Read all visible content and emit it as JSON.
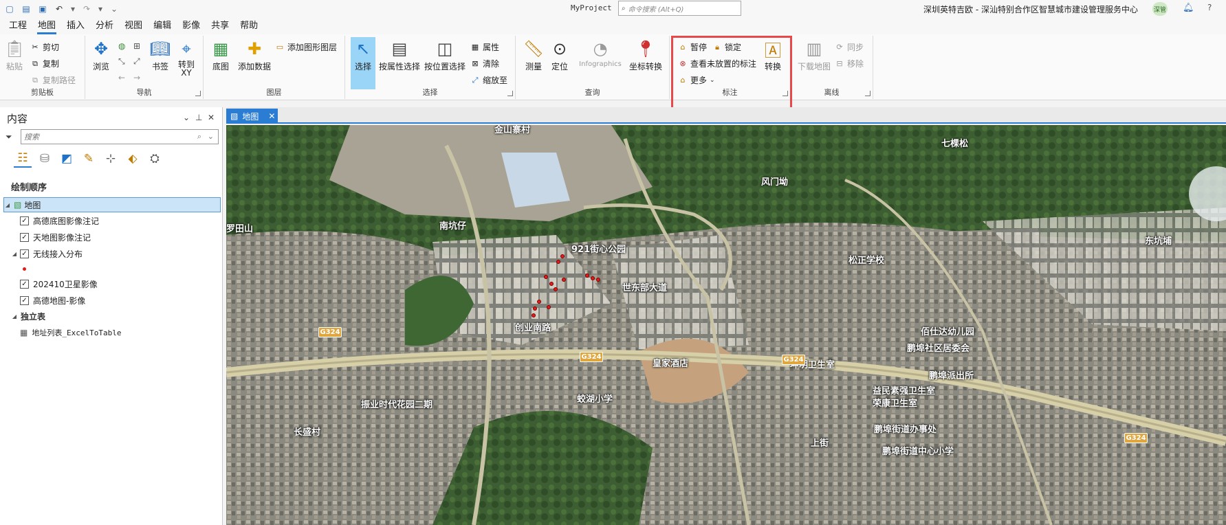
{
  "titlebar": {
    "project_name": "MyProject",
    "command_search_placeholder": "命令搜索 (Alt+Q)",
    "organization": "深圳英特吉欧 - 深汕特别合作区智慧城市建设管理服务中心",
    "user_badge": "深管",
    "qat_icons": [
      "new-project-icon",
      "open-project-icon",
      "save-project-icon",
      "undo-icon",
      "undo-dropdown-icon",
      "redo-icon",
      "redo-dropdown-icon",
      "customize-qat-icon"
    ]
  },
  "menu": {
    "items": [
      "工程",
      "地图",
      "插入",
      "分析",
      "视图",
      "编辑",
      "影像",
      "共享",
      "帮助"
    ],
    "active": "地图"
  },
  "ribbon": {
    "clipboard": {
      "label": "剪贴板",
      "paste": "粘贴",
      "cut": "剪切",
      "copy": "复制",
      "copy_path": "复制路径"
    },
    "navigate": {
      "label": "导航",
      "explore": "浏览",
      "bookmarks": "书签",
      "goto_xy": "转到\nXY"
    },
    "layer": {
      "label": "图层",
      "basemap": "底图",
      "add_data": "添加数据",
      "add_graphics": "添加图形图层"
    },
    "selection": {
      "label": "选择",
      "select": "选择",
      "by_attr": "按属性选择",
      "by_loc": "按位置选择",
      "attributes": "属性",
      "clear": "清除",
      "zoom_to": "缩放至"
    },
    "inquiry": {
      "label": "查询",
      "measure": "测量",
      "locate": "定位",
      "infographics": "Infographics",
      "convert_coords": "坐标转换"
    },
    "labeling": {
      "label": "标注",
      "pause": "暂停",
      "lock": "锁定",
      "view_unplaced": "查看未放置的标注",
      "more": "更多",
      "convert": "转换"
    },
    "offline": {
      "label": "离线",
      "download_map": "下载地图",
      "sync": "同步",
      "remove": "移除"
    }
  },
  "contents": {
    "title": "内容",
    "search_placeholder": "搜索",
    "section": "绘制顺序",
    "map_item": "地图",
    "layers": [
      {
        "name": "高德底图影像注记",
        "checked": true
      },
      {
        "name": "天地图影像注记",
        "checked": true
      },
      {
        "name": "无线接入分布",
        "checked": true
      },
      {
        "name": "202410卫星影像",
        "checked": true
      },
      {
        "name": "高德地图-影像",
        "checked": true
      }
    ],
    "standalone_section": "独立表",
    "table_item": "地址列表_ExcelToTable"
  },
  "view": {
    "tab_label": "地图"
  },
  "map_labels": [
    "金山寨村",
    "七棵松",
    "风门坳",
    "罗田山",
    "南坑仔",
    "921街心公园",
    "东坑埔",
    "松正学校",
    "世东部大道",
    "佰仕达幼儿园",
    "鹏埠社区居委会",
    "鹏埠派出所",
    "益民素强卫生室",
    "荣康卫生室",
    "皇家酒店",
    "坤明卫生室",
    "蛟湖小学",
    "鹏埠街道办事处",
    "鹏埠街道中心小学",
    "长盛村",
    "上街",
    "创业南路",
    "振业时代花园二期"
  ],
  "road_shields": [
    "G324",
    "G324",
    "G324",
    "G324"
  ]
}
